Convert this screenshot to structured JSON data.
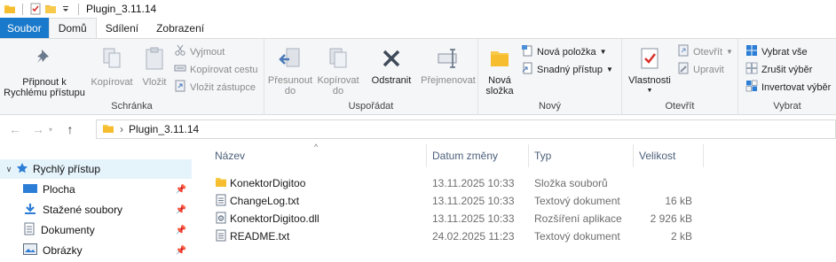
{
  "window": {
    "title": "Plugin_3.11.14"
  },
  "tabs": [
    {
      "label": "Soubor"
    },
    {
      "label": "Domů"
    },
    {
      "label": "Sdílení"
    },
    {
      "label": "Zobrazení"
    }
  ],
  "ribbon": {
    "clipboard": {
      "group_label": "Schránka",
      "pin_line1": "Připnout k",
      "pin_line2": "Rychlému přístupu",
      "copy": "Kopírovat",
      "paste": "Vložit",
      "cut": "Vyjmout",
      "copy_path": "Kopírovat cestu",
      "paste_shortcut": "Vložit zástupce"
    },
    "organize": {
      "group_label": "Uspořádat",
      "move_line1": "Přesunout",
      "move_line2": "do",
      "copy_line1": "Kopírovat",
      "copy_line2": "do",
      "delete": "Odstranit",
      "rename": "Přejmenovat"
    },
    "new": {
      "group_label": "Nový",
      "folder_line1": "Nová",
      "folder_line2": "složka",
      "new_item": "Nová položka",
      "easy_access": "Snadný přístup"
    },
    "open": {
      "group_label": "Otevřít",
      "properties": "Vlastnosti",
      "open": "Otevřít",
      "edit": "Upravit"
    },
    "select": {
      "group_label": "Vybrat",
      "select_all": "Vybrat vše",
      "select_none": "Zrušit výběr",
      "invert": "Invertovat výběr"
    }
  },
  "address": {
    "path": "Plugin_3.11.14"
  },
  "nav": {
    "quick_access": "Rychlý přístup",
    "items": [
      {
        "label": "Plocha"
      },
      {
        "label": "Stažené soubory"
      },
      {
        "label": "Dokumenty"
      },
      {
        "label": "Obrázky"
      }
    ]
  },
  "columns": {
    "name": "Název",
    "date": "Datum změny",
    "type": "Typ",
    "size": "Velikost"
  },
  "files": [
    {
      "name": "KonektorDigitoo",
      "date": "13.11.2025 10:33",
      "type": "Složka souborů",
      "size": "",
      "icon": "folder-icon"
    },
    {
      "name": "ChangeLog.txt",
      "date": "13.11.2025 10:33",
      "type": "Textový dokument",
      "size": "16 kB",
      "icon": "text-file-icon"
    },
    {
      "name": "KonektorDigitoo.dll",
      "date": "13.11.2025 10:33",
      "type": "Rozšíření aplikace",
      "size": "2 926 kB",
      "icon": "dll-file-icon"
    },
    {
      "name": "README.txt",
      "date": "24.02.2025 11:23",
      "type": "Textový dokument",
      "size": "2 kB",
      "icon": "text-file-icon"
    }
  ],
  "colors": {
    "accent": "#1979ca",
    "folder": "#f8c94a",
    "selection": "#e5f3fb",
    "header_text": "#4c607a"
  }
}
